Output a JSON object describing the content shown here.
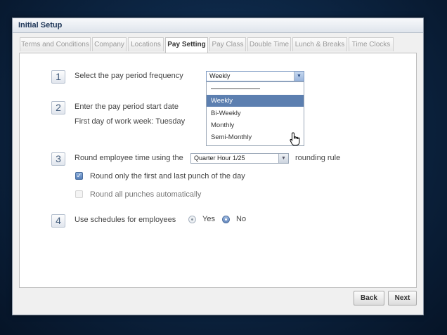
{
  "window": {
    "title": "Initial Setup"
  },
  "tabs": [
    {
      "label": "Terms and Conditions"
    },
    {
      "label": "Company"
    },
    {
      "label": "Locations"
    },
    {
      "label": "Pay Setting",
      "active": true
    },
    {
      "label": "Pay Class"
    },
    {
      "label": "Double Time"
    },
    {
      "label": "Lunch & Breaks"
    },
    {
      "label": "Time Clocks"
    }
  ],
  "steps": {
    "s1": {
      "num": "1",
      "label": "Select the pay period frequency",
      "value": "Weekly"
    },
    "s2": {
      "num": "2",
      "label": "Enter the pay period start date",
      "sub": "First day of work week: Tuesday"
    },
    "s3": {
      "num": "3",
      "label": "Round employee time using the",
      "value": "Quarter Hour 1/25",
      "suffix": "rounding rule",
      "option1": "Round only the first and last punch of the day",
      "option1_checked": true,
      "option2": "Round all punches automatically",
      "option2_checked": false
    },
    "s4": {
      "num": "4",
      "label": "Use schedules for employees",
      "yes": "Yes",
      "no": "No",
      "selected": "No"
    }
  },
  "dropdown": {
    "options": [
      "-------------------------",
      "Weekly",
      "Bi-Weekly",
      "Monthly",
      "Semi-Monthly"
    ],
    "highlighted": "Weekly"
  },
  "buttons": {
    "back": "Back",
    "next": "Next"
  },
  "icons": {
    "cursor": "hand-pointer-icon",
    "dropdown_arrow": "chevron-down-icon"
  }
}
